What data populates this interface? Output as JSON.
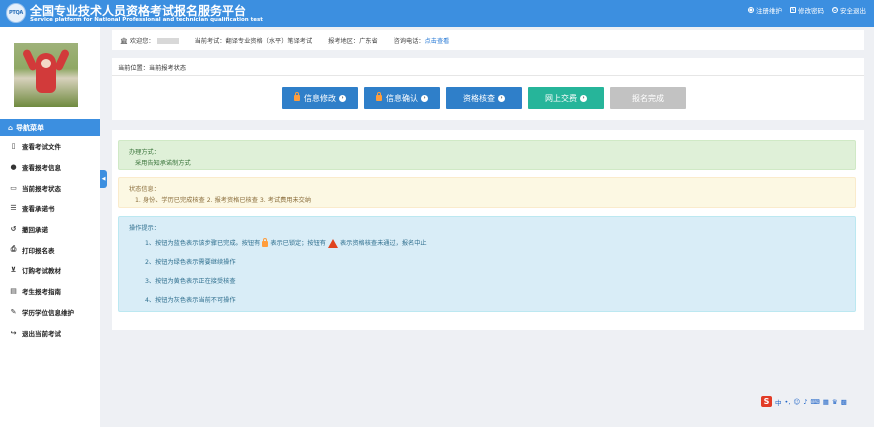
{
  "header": {
    "logo_text": "PTQA",
    "title": "全国专业技术人员资格考试报名服务平台",
    "subtitle": "Service platform for National Professional and technician qualification test",
    "links": [
      {
        "icon": "user-circle-icon",
        "label": "注册维护"
      },
      {
        "icon": "edit-icon",
        "label": "修改密码"
      },
      {
        "icon": "power-icon",
        "label": "安全退出"
      }
    ]
  },
  "sidebar": {
    "nav_title": "导航菜单",
    "items": [
      {
        "icon": "file-icon",
        "label": "查看考试文件"
      },
      {
        "icon": "info-icon",
        "label": "查看报考信息"
      },
      {
        "icon": "monitor-icon",
        "label": "当前报考状态"
      },
      {
        "icon": "list-icon",
        "label": "查看承诺书"
      },
      {
        "icon": "undo-icon",
        "label": "撤回承诺"
      },
      {
        "icon": "print-icon",
        "label": "打印报名表"
      },
      {
        "icon": "cart-icon",
        "label": "订购考试教材"
      },
      {
        "icon": "book-icon",
        "label": "考生报考指南"
      },
      {
        "icon": "pencil-icon",
        "label": "学历学位信息维护"
      },
      {
        "icon": "signout-icon",
        "label": "退出当前考试"
      }
    ]
  },
  "topbar": {
    "welcome": "欢迎您：",
    "exam_label": "当前考试：",
    "exam_value": "翻译专业资格（水平）笔译考试",
    "region_label": "报考地区：",
    "region_value": "广东省",
    "phone_label": "咨询电话：",
    "phone_link": "点击查看"
  },
  "breadcrumb": "当前位置：当前报考状态",
  "steps": [
    {
      "label": "信息修改",
      "locked": true,
      "color": "#2f7fc9"
    },
    {
      "label": "信息确认",
      "locked": true,
      "color": "#2f7fc9"
    },
    {
      "label": "资格核查",
      "locked": false,
      "color": "#2f7fc9"
    },
    {
      "label": "网上交费",
      "locked": false,
      "color": "#26b59a"
    },
    {
      "label": "报名完成",
      "locked": false,
      "color": "#c2c2c2"
    }
  ],
  "boxes": {
    "method_title": "办理方式：",
    "method_text": "采用告知承诺制方式",
    "status_title": "状态信息：",
    "status_text": "1. 身份、学历已完成核查 2. 报考资格已核查 3. 考试费用未交纳",
    "hint_title": "操作提示：",
    "hint1_a": "1、按钮为蓝色表示该步骤已完成。按钮有",
    "hint1_b": "表示已锁定；按钮有",
    "hint1_c": "表示资格核查未通过，报名中止",
    "hint2": "2、按钮为绿色表示需要继续操作",
    "hint3": "3、按钮为黄色表示正在接受核查",
    "hint4": "4、按钮为灰色表示当前不可操作"
  },
  "ime": {
    "brand": "S",
    "lang": "中"
  }
}
